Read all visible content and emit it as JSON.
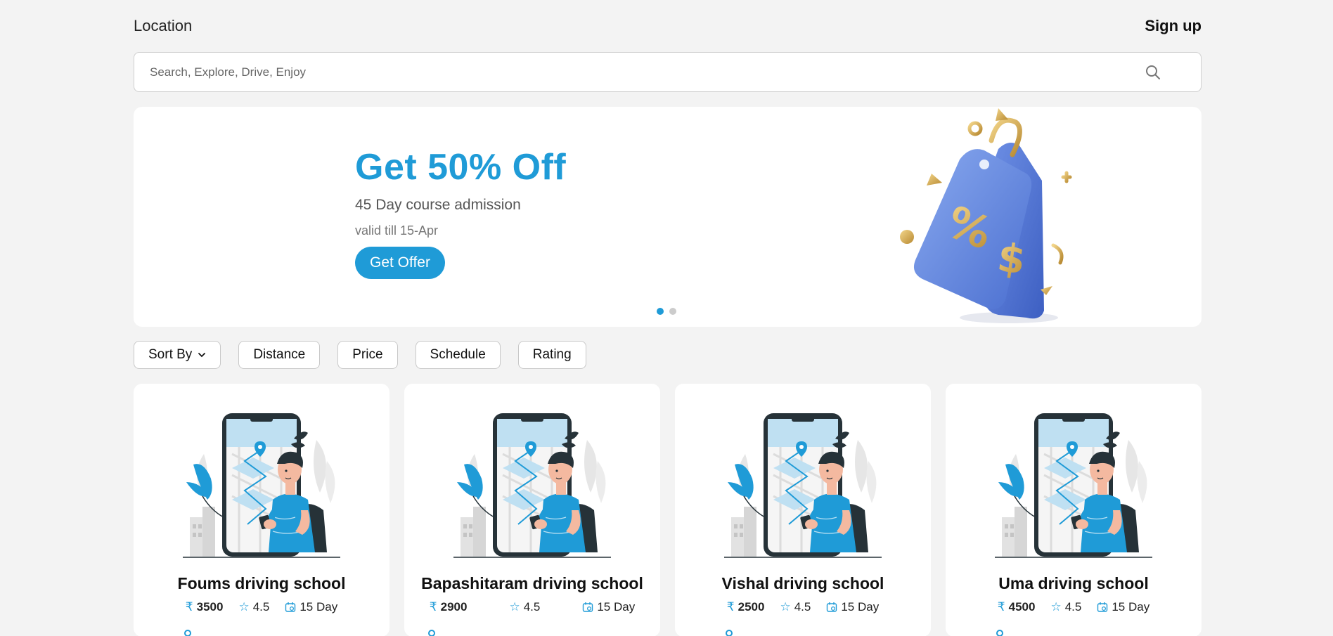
{
  "header": {
    "location_label": "Location",
    "signup_label": "Sign up"
  },
  "search": {
    "placeholder": "Search, Explore, Drive, Enjoy",
    "value": ""
  },
  "banner": {
    "title": "Get 50% Off",
    "subtitle": "45 Day course admission",
    "validity": "valid till 15-Apr",
    "cta_label": "Get Offer",
    "slides_total": 2,
    "active_slide": 1
  },
  "filters": [
    {
      "label": "Sort By",
      "has_dropdown": true
    },
    {
      "label": "Distance"
    },
    {
      "label": "Price"
    },
    {
      "label": "Schedule"
    },
    {
      "label": "Rating"
    }
  ],
  "schools": [
    {
      "name": "Foums driving school",
      "price": "3500",
      "rating": "4.5",
      "duration": "15 Day"
    },
    {
      "name": "Bapashitaram driving school",
      "price": "2900",
      "rating": "4.5",
      "duration": "15 Day"
    },
    {
      "name": "Vishal driving school",
      "price": "2500",
      "rating": "4.5",
      "duration": "15 Day"
    },
    {
      "name": "Uma driving school",
      "price": "4500",
      "rating": "4.5",
      "duration": "15 Day"
    }
  ],
  "icons": {
    "currency": "rupee-icon",
    "rating": "star-icon",
    "duration": "calendar-icon",
    "search": "search-icon"
  },
  "colors": {
    "accent": "#1f9bd7",
    "background": "#f3f3f3",
    "card": "#ffffff",
    "tag": "#5b82d8",
    "gold": "#d9b25c"
  }
}
